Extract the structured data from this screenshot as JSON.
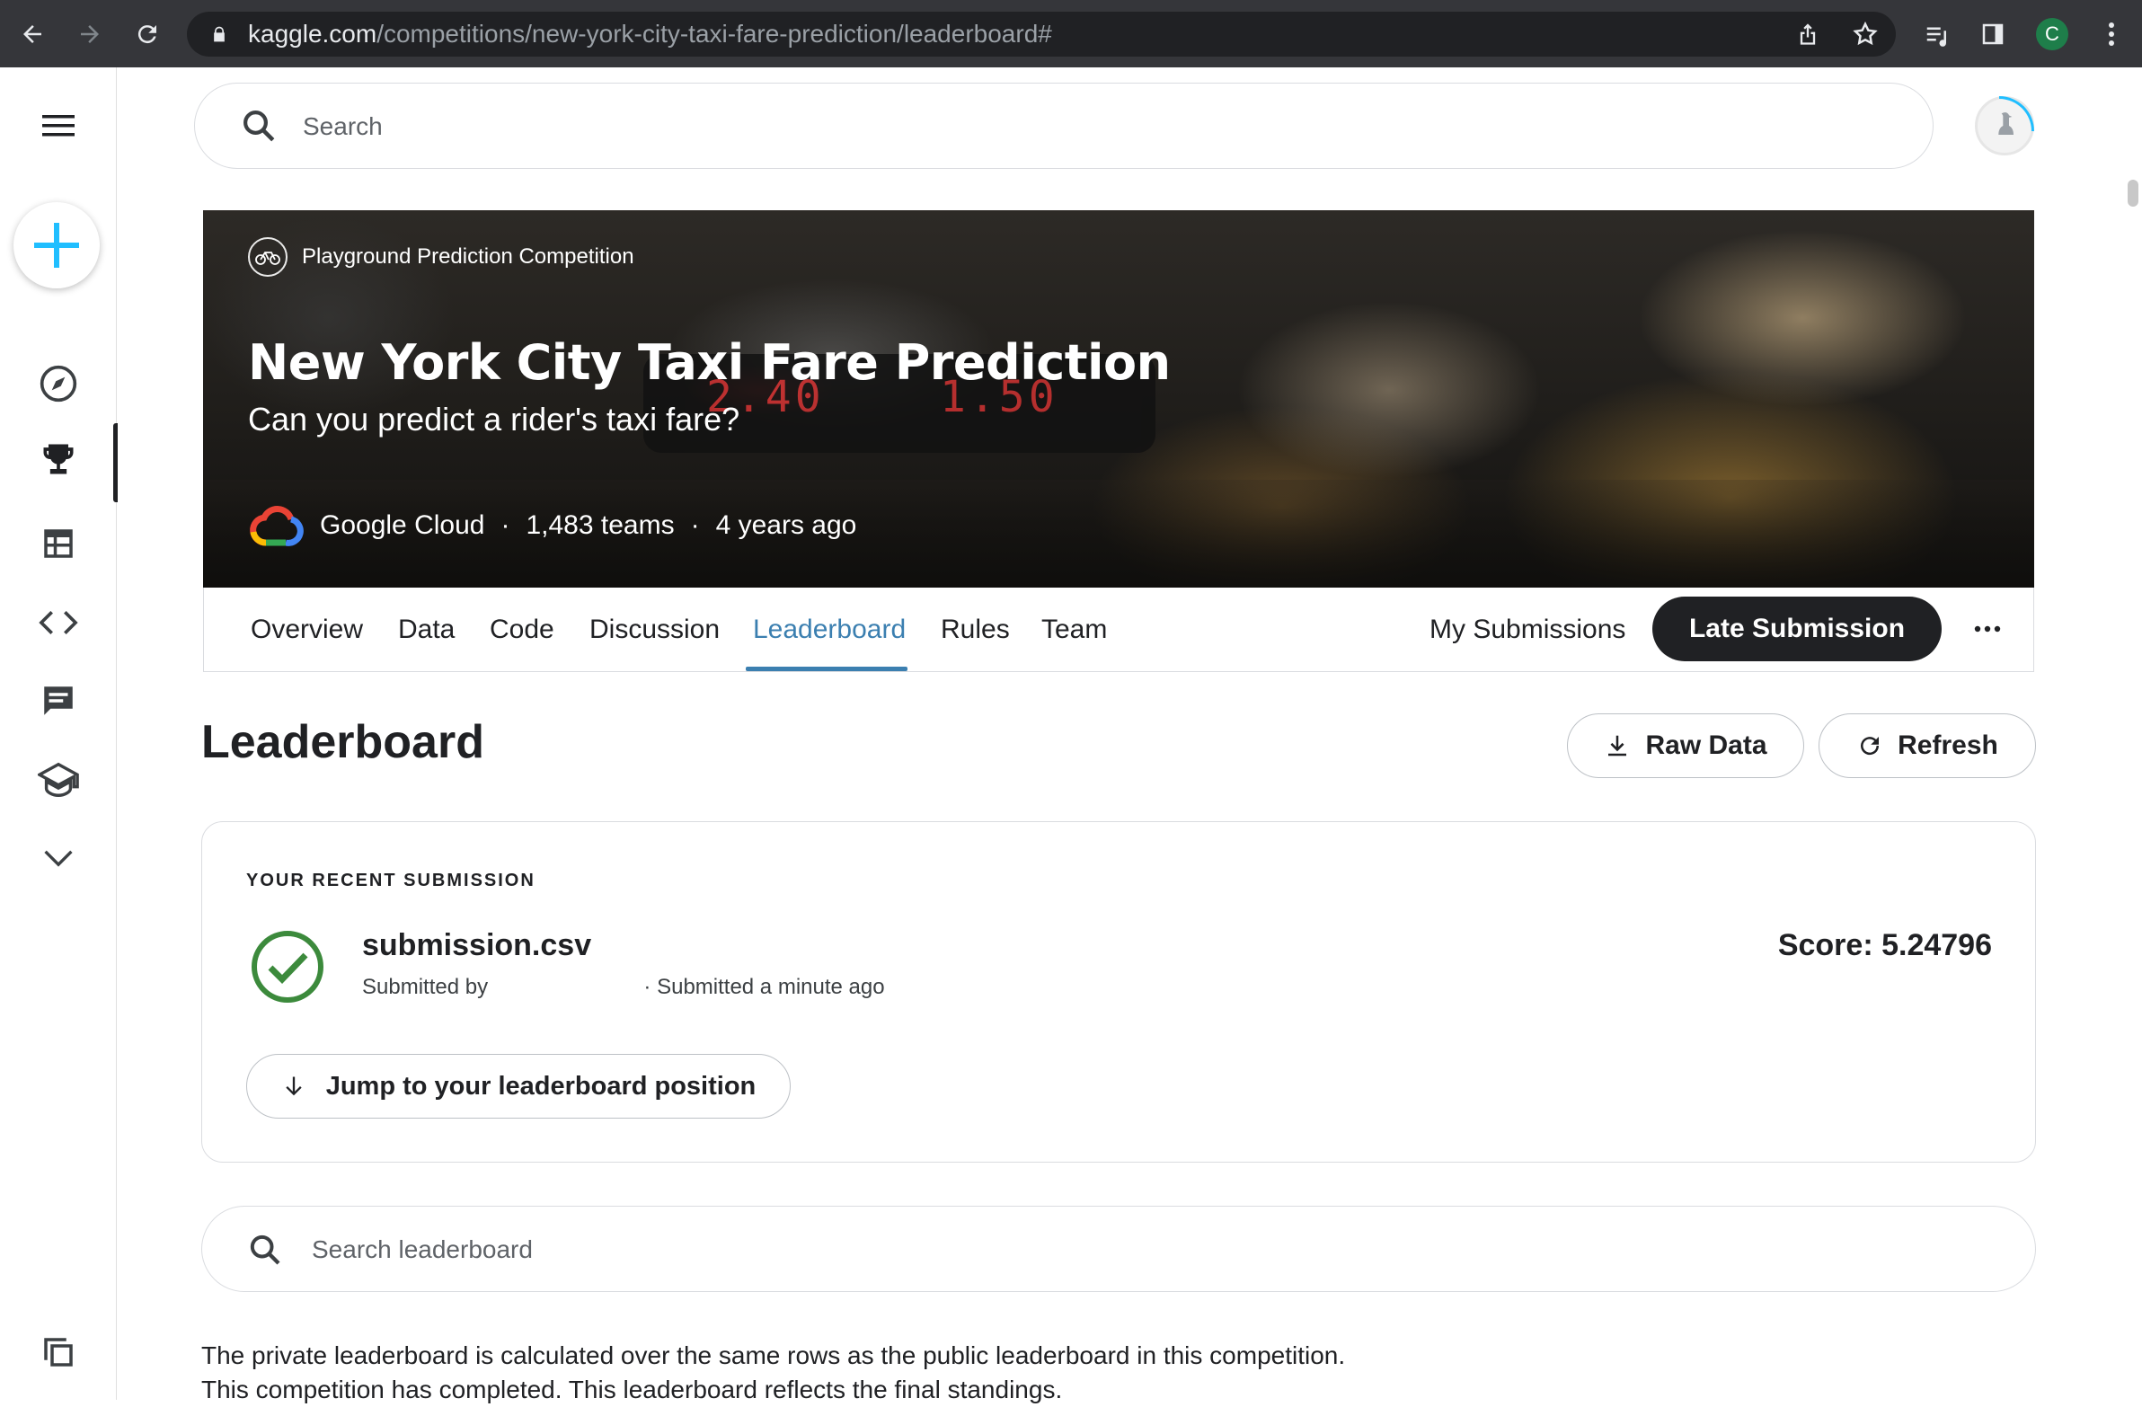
{
  "browser": {
    "url_host": "kaggle.com",
    "url_path": "/competitions/new-york-city-taxi-fare-prediction/leaderboard#",
    "profile_initial": "C"
  },
  "search": {
    "placeholder": "Search"
  },
  "banner": {
    "eyebrow": "Playground Prediction Competition",
    "title": "New York City Taxi Fare Prediction",
    "subtitle": "Can you predict a rider's taxi fare?",
    "host": "Google Cloud",
    "teams": "1,483 teams",
    "age": "4 years ago",
    "separator": "·",
    "meter_left": "2.40",
    "meter_right": "1.50"
  },
  "tabs": [
    {
      "label": "Overview"
    },
    {
      "label": "Data"
    },
    {
      "label": "Code"
    },
    {
      "label": "Discussion"
    },
    {
      "label": "Leaderboard",
      "active": true
    },
    {
      "label": "Rules"
    },
    {
      "label": "Team"
    }
  ],
  "actions": {
    "my_submissions": "My Submissions",
    "late_submission": "Late Submission",
    "more": "···"
  },
  "leaderboard": {
    "title": "Leaderboard",
    "raw_data": "Raw Data",
    "refresh": "Refresh"
  },
  "recent": {
    "eyebrow": "YOUR RECENT SUBMISSION",
    "filename": "submission.csv",
    "submitted_by": "Submitted by",
    "submitted_when": "· Submitted a minute ago",
    "score": "Score: 5.24796",
    "jump": "Jump to your leaderboard position"
  },
  "lb_search": {
    "placeholder": "Search leaderboard"
  },
  "info": {
    "line1": "The private leaderboard is calculated over the same rows as the public leaderboard in this competition.",
    "line2": "This competition has completed. This leaderboard reflects the final standings."
  },
  "colors": {
    "accent": "#3b7fb0",
    "dark_button": "#202124",
    "success": "#3c8a3c",
    "chrome_bg": "#35363a"
  }
}
